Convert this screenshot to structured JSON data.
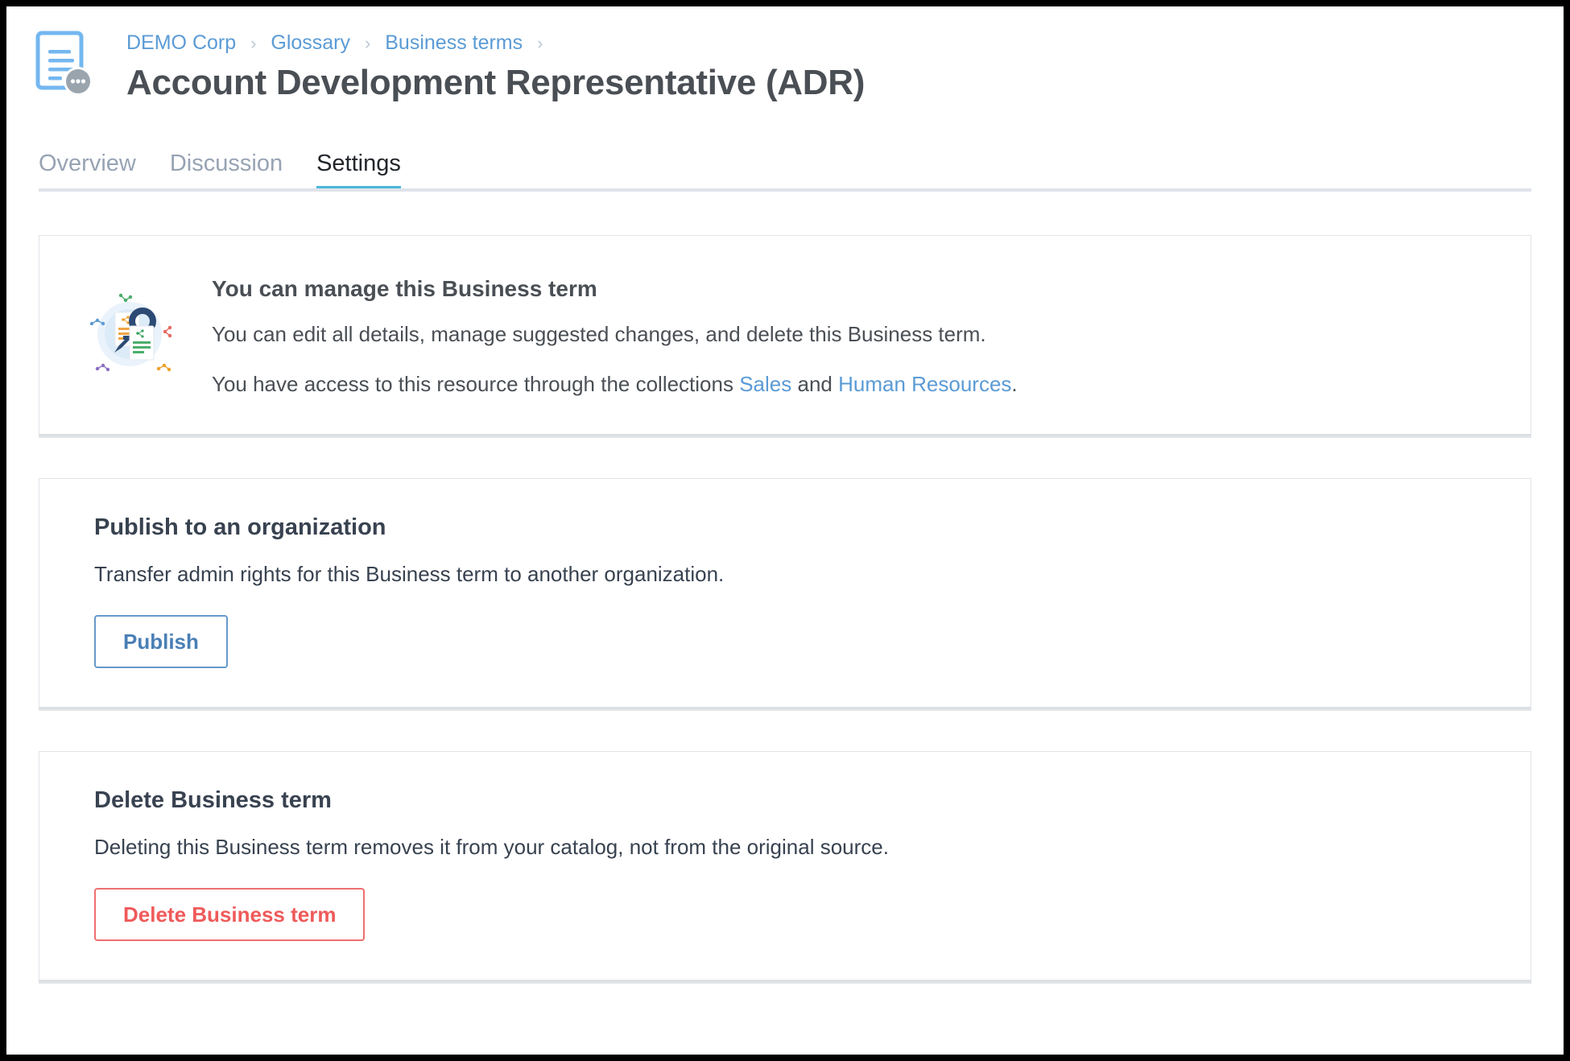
{
  "header": {
    "icon": "business-term-document-icon",
    "breadcrumb": [
      {
        "label": "DEMO Corp"
      },
      {
        "label": "Glossary"
      },
      {
        "label": "Business terms"
      }
    ],
    "breadcrumb_separator": "›",
    "title": "Account Development Representative (ADR)"
  },
  "tabs": [
    {
      "label": "Overview",
      "active": false
    },
    {
      "label": "Discussion",
      "active": false
    },
    {
      "label": "Settings",
      "active": true
    }
  ],
  "permission_card": {
    "illustration": "key-and-documents-illustration",
    "title": "You can manage this Business term",
    "description": "You can edit all details, manage suggested changes, and delete this Business term.",
    "access_prefix": "You have access to this resource through the collections ",
    "access_link_1": "Sales",
    "access_conjunction": " and ",
    "access_link_2": "Human Resources",
    "access_suffix": "."
  },
  "publish_card": {
    "title": "Publish to an organization",
    "description": "Transfer admin rights for this Business term to another organization.",
    "button_label": "Publish"
  },
  "delete_card": {
    "title": "Delete Business term",
    "description": "Deleting this Business term removes it from your catalog, not from the original source.",
    "button_label": "Delete Business term"
  },
  "colors": {
    "accent_blue": "#5b9bd5",
    "tab_active_underline": "#4cb8db",
    "danger_red": "#ef5a5a",
    "title_gray": "#4a4f55",
    "card_border": "#e1e4e8"
  }
}
